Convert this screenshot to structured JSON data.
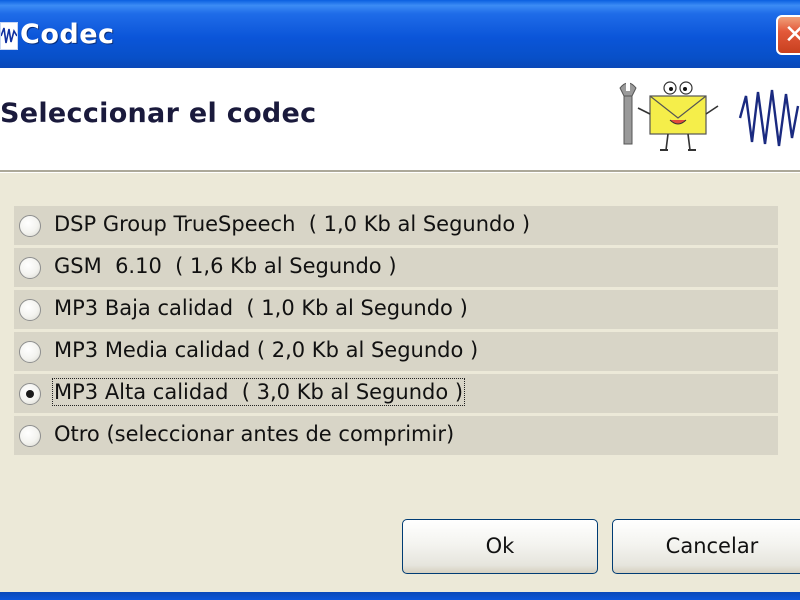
{
  "window": {
    "title": "Codec"
  },
  "header": {
    "heading": "Seleccionar el codec"
  },
  "codec_options": [
    {
      "label": "DSP Group TrueSpeech  ( 1,0 Kb al Segundo )",
      "selected": false
    },
    {
      "label": "GSM  6.10  ( 1,6 Kb al Segundo )",
      "selected": false
    },
    {
      "label": "MP3 Baja calidad  ( 1,0 Kb al Segundo )",
      "selected": false
    },
    {
      "label": "MP3 Media calidad ( 2,0 Kb al Segundo )",
      "selected": false
    },
    {
      "label": "MP3 Alta calidad  ( 3,0 Kb al Segundo )",
      "selected": true
    },
    {
      "label": "Otro (seleccionar antes de comprimir)",
      "selected": false
    }
  ],
  "buttons": {
    "ok": "Ok",
    "cancel": "Cancelar"
  },
  "icons": {
    "app": "waveform-icon",
    "close": "close-icon",
    "header_mascot": "envelope-mascot-icon",
    "header_wave": "waveform-icon",
    "header_tool": "wrench-icon"
  },
  "colors": {
    "titlebar": "#0B55D9",
    "close": "#E3593A",
    "option_bg": "#D8D5C7",
    "window_bg": "#ECE9D8",
    "envelope": "#F5EE4A"
  }
}
